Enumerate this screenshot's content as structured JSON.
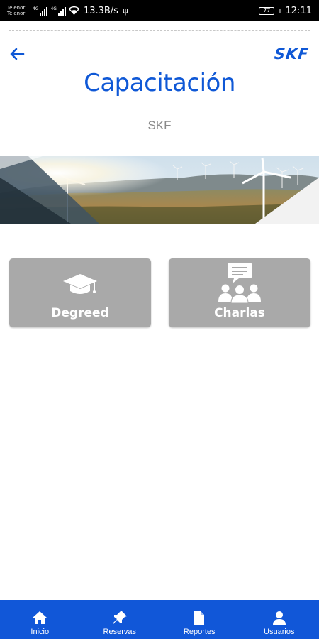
{
  "status_bar": {
    "carrier_1": "Telenor",
    "carrier_2": "Telenor",
    "network_speed": "13.3B/s",
    "battery_level": "77",
    "time": "12:11"
  },
  "header": {
    "back_icon": "arrow-left-icon",
    "brand": "SKF",
    "title": "Capacitación",
    "subtitle": "SKF"
  },
  "banner": {
    "description_icon": "wind-turbine-landscape-image"
  },
  "tiles": [
    {
      "label": "Degreed",
      "icon": "graduation-cap-icon"
    },
    {
      "label": "Charlas",
      "icon": "group-chat-icon"
    }
  ],
  "bottom_nav": {
    "items": [
      {
        "label": "Inicio",
        "icon": "home-icon"
      },
      {
        "label": "Reservas",
        "icon": "pin-icon"
      },
      {
        "label": "Reportes",
        "icon": "document-icon"
      },
      {
        "label": "Usuarios",
        "icon": "user-icon"
      }
    ]
  },
  "colors": {
    "brand_blue": "#1157d8",
    "tile_gray": "#a9a9a9",
    "subtitle_gray": "#8a8a8a"
  }
}
